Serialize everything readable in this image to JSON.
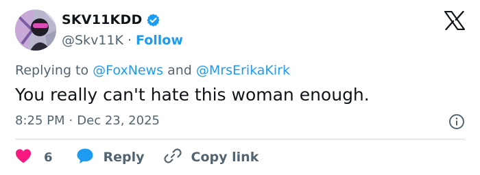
{
  "author": {
    "display_name": "SKV11KDD",
    "handle": "@Skv11K",
    "separator": "·",
    "follow_label": "Follow"
  },
  "reply_context": {
    "prefix": "Replying to",
    "mention_1": "@FoxNews",
    "joiner": "and",
    "mention_2": "@MrsErikaKirk"
  },
  "tweet": {
    "text": "You really can't hate this woman enough."
  },
  "meta": {
    "time": "8:25 PM",
    "separator": "·",
    "date": "Dec 23, 2025"
  },
  "actions": {
    "like_count": "6",
    "reply_label": "Reply",
    "copy_link_label": "Copy link"
  },
  "colors": {
    "accent": "#1d9bf0",
    "heart": "#f91880",
    "muted": "#536471",
    "text": "#0f1419",
    "divider": "#cfd9de"
  },
  "icons": [
    "verified-badge-icon",
    "x-logo-icon",
    "info-icon",
    "heart-icon",
    "reply-bubble-icon",
    "link-icon"
  ]
}
